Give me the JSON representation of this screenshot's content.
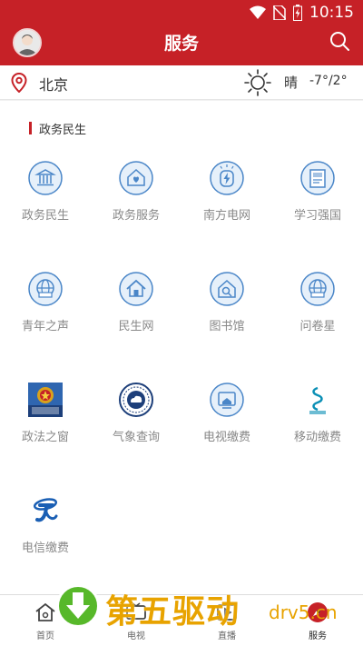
{
  "status_bar": {
    "time": "10:15"
  },
  "header": {
    "title": "服务"
  },
  "weather": {
    "city": "北京",
    "condition": "晴",
    "temperature": "-7°/2°"
  },
  "section": {
    "title": "政务民生"
  },
  "services": [
    {
      "label": "政务民生",
      "icon": "government-building-icon"
    },
    {
      "label": "政务服务",
      "icon": "house-heart-icon"
    },
    {
      "label": "南方电网",
      "icon": "power-bolt-icon"
    },
    {
      "label": "学习强国",
      "icon": "book-flag-icon"
    },
    {
      "label": "青年之声",
      "icon": "globe-monitor-icon"
    },
    {
      "label": "民生网",
      "icon": "home-icon"
    },
    {
      "label": "图书馆",
      "icon": "library-search-icon"
    },
    {
      "label": "问卷星",
      "icon": "globe-monitor-icon"
    },
    {
      "label": "政法之窗",
      "icon": "emblem-logo-icon"
    },
    {
      "label": "气象查询",
      "icon": "meteorology-logo-icon"
    },
    {
      "label": "电视缴费",
      "icon": "tv-house-icon"
    },
    {
      "label": "移动缴费",
      "icon": "china-mobile-logo-icon"
    },
    {
      "label": "电信缴费",
      "icon": "china-telecom-logo-icon"
    }
  ],
  "bottom_nav": [
    {
      "label": "首页",
      "icon": "home-icon"
    },
    {
      "label": "电视",
      "icon": "tv-icon"
    },
    {
      "label": "直播",
      "icon": "play-icon"
    },
    {
      "label": "服务",
      "icon": "compass-icon",
      "active": true
    }
  ],
  "watermark": {
    "cn": "第五驱动",
    "en": "drv5.cn"
  },
  "colors": {
    "brand_red": "#c62127",
    "icon_blue": "#4a86c8",
    "icon_fill": "#e6f0fa"
  }
}
